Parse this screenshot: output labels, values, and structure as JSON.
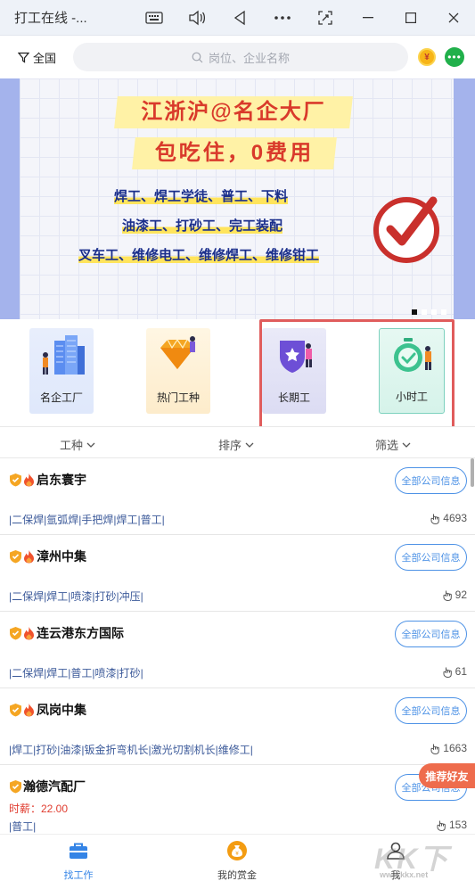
{
  "window": {
    "title": "打工在线 -...",
    "buttons": [
      "keyboard-icon",
      "volume-icon",
      "back-icon",
      "more-icon",
      "screenshot-icon",
      "minimize-icon",
      "maximize-icon",
      "close-icon"
    ]
  },
  "topbar": {
    "region": "全国",
    "search_placeholder": "岗位、企业名称",
    "coin_symbol": "¥",
    "chat_symbol": "•••"
  },
  "banner": {
    "headline1": "江浙沪@名企大厂",
    "headline2": "包吃住，0费用",
    "lines": [
      "焊工、焊工学徒、普工、下料",
      "油漆工、打砂工、完工装配",
      "叉车工、维修电工、维修焊工、维修钳工"
    ],
    "slide_count": 4,
    "active_slide": 0
  },
  "categories": [
    {
      "label": "名企工厂",
      "icon": "factory-buildings-icon"
    },
    {
      "label": "热门工种",
      "icon": "diamond-icon"
    },
    {
      "label": "长期工",
      "icon": "star-shield-icon"
    },
    {
      "label": "小时工",
      "icon": "stopwatch-icon"
    }
  ],
  "filters": {
    "type": "工种",
    "sort": "排序",
    "filter": "筛选"
  },
  "jobs": [
    {
      "company": "启东寰宇",
      "tags": "|二保焊|氩弧焊|手把焊|焊工|普工|",
      "views": "4693",
      "button": "全部公司信息",
      "salary": ""
    },
    {
      "company": "漳州中集",
      "tags": "|二保焊|焊工|喷漆|打砂|冲压|",
      "views": "92",
      "button": "全部公司信息",
      "salary": ""
    },
    {
      "company": "连云港东方国际",
      "tags": "|二保焊|焊工|普工|喷漆|打砂|",
      "views": "61",
      "button": "全部公司信息",
      "salary": ""
    },
    {
      "company": "凤岗中集",
      "tags": "|焊工|打砂|油漆|钣金折弯机长|激光切割机长|维修工|",
      "views": "1663",
      "button": "全部公司信息",
      "salary": ""
    },
    {
      "company": "瀚德汽配厂",
      "tags": "|普工|",
      "views": "153",
      "button": "全部公司信息",
      "salary": "时薪：22.00"
    }
  ],
  "recommend": "推荐好友",
  "bottom_nav": [
    {
      "label": "找工作",
      "icon": "briefcase-icon",
      "active": true
    },
    {
      "label": "我的赏金",
      "icon": "money-bag-icon",
      "active": false
    },
    {
      "label": "我",
      "icon": "user-icon",
      "active": false
    }
  ],
  "watermark": {
    "text": "KK下载",
    "url": "www.kkx.net"
  },
  "colors": {
    "accent": "#3484e6",
    "highlight_box": "#e05c5c",
    "salary": "#e03c2f",
    "headline": "#d93a2b",
    "banner_text": "#1b2f8c"
  }
}
